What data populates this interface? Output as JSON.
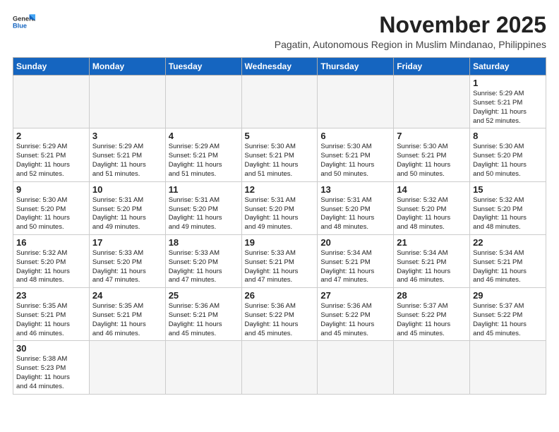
{
  "header": {
    "logo_general": "General",
    "logo_blue": "Blue",
    "month_year": "November 2025",
    "subtitle": "Pagatin, Autonomous Region in Muslim Mindanao, Philippines"
  },
  "weekdays": [
    "Sunday",
    "Monday",
    "Tuesday",
    "Wednesday",
    "Thursday",
    "Friday",
    "Saturday"
  ],
  "weeks": [
    [
      {
        "day": "",
        "info": ""
      },
      {
        "day": "",
        "info": ""
      },
      {
        "day": "",
        "info": ""
      },
      {
        "day": "",
        "info": ""
      },
      {
        "day": "",
        "info": ""
      },
      {
        "day": "",
        "info": ""
      },
      {
        "day": "1",
        "info": "Sunrise: 5:29 AM\nSunset: 5:21 PM\nDaylight: 11 hours\nand 52 minutes."
      }
    ],
    [
      {
        "day": "2",
        "info": "Sunrise: 5:29 AM\nSunset: 5:21 PM\nDaylight: 11 hours\nand 52 minutes."
      },
      {
        "day": "3",
        "info": "Sunrise: 5:29 AM\nSunset: 5:21 PM\nDaylight: 11 hours\nand 51 minutes."
      },
      {
        "day": "4",
        "info": "Sunrise: 5:29 AM\nSunset: 5:21 PM\nDaylight: 11 hours\nand 51 minutes."
      },
      {
        "day": "5",
        "info": "Sunrise: 5:30 AM\nSunset: 5:21 PM\nDaylight: 11 hours\nand 51 minutes."
      },
      {
        "day": "6",
        "info": "Sunrise: 5:30 AM\nSunset: 5:21 PM\nDaylight: 11 hours\nand 50 minutes."
      },
      {
        "day": "7",
        "info": "Sunrise: 5:30 AM\nSunset: 5:21 PM\nDaylight: 11 hours\nand 50 minutes."
      },
      {
        "day": "8",
        "info": "Sunrise: 5:30 AM\nSunset: 5:20 PM\nDaylight: 11 hours\nand 50 minutes."
      }
    ],
    [
      {
        "day": "9",
        "info": "Sunrise: 5:30 AM\nSunset: 5:20 PM\nDaylight: 11 hours\nand 50 minutes."
      },
      {
        "day": "10",
        "info": "Sunrise: 5:31 AM\nSunset: 5:20 PM\nDaylight: 11 hours\nand 49 minutes."
      },
      {
        "day": "11",
        "info": "Sunrise: 5:31 AM\nSunset: 5:20 PM\nDaylight: 11 hours\nand 49 minutes."
      },
      {
        "day": "12",
        "info": "Sunrise: 5:31 AM\nSunset: 5:20 PM\nDaylight: 11 hours\nand 49 minutes."
      },
      {
        "day": "13",
        "info": "Sunrise: 5:31 AM\nSunset: 5:20 PM\nDaylight: 11 hours\nand 48 minutes."
      },
      {
        "day": "14",
        "info": "Sunrise: 5:32 AM\nSunset: 5:20 PM\nDaylight: 11 hours\nand 48 minutes."
      },
      {
        "day": "15",
        "info": "Sunrise: 5:32 AM\nSunset: 5:20 PM\nDaylight: 11 hours\nand 48 minutes."
      }
    ],
    [
      {
        "day": "16",
        "info": "Sunrise: 5:32 AM\nSunset: 5:20 PM\nDaylight: 11 hours\nand 48 minutes."
      },
      {
        "day": "17",
        "info": "Sunrise: 5:33 AM\nSunset: 5:20 PM\nDaylight: 11 hours\nand 47 minutes."
      },
      {
        "day": "18",
        "info": "Sunrise: 5:33 AM\nSunset: 5:20 PM\nDaylight: 11 hours\nand 47 minutes."
      },
      {
        "day": "19",
        "info": "Sunrise: 5:33 AM\nSunset: 5:21 PM\nDaylight: 11 hours\nand 47 minutes."
      },
      {
        "day": "20",
        "info": "Sunrise: 5:34 AM\nSunset: 5:21 PM\nDaylight: 11 hours\nand 47 minutes."
      },
      {
        "day": "21",
        "info": "Sunrise: 5:34 AM\nSunset: 5:21 PM\nDaylight: 11 hours\nand 46 minutes."
      },
      {
        "day": "22",
        "info": "Sunrise: 5:34 AM\nSunset: 5:21 PM\nDaylight: 11 hours\nand 46 minutes."
      }
    ],
    [
      {
        "day": "23",
        "info": "Sunrise: 5:35 AM\nSunset: 5:21 PM\nDaylight: 11 hours\nand 46 minutes."
      },
      {
        "day": "24",
        "info": "Sunrise: 5:35 AM\nSunset: 5:21 PM\nDaylight: 11 hours\nand 46 minutes."
      },
      {
        "day": "25",
        "info": "Sunrise: 5:36 AM\nSunset: 5:21 PM\nDaylight: 11 hours\nand 45 minutes."
      },
      {
        "day": "26",
        "info": "Sunrise: 5:36 AM\nSunset: 5:22 PM\nDaylight: 11 hours\nand 45 minutes."
      },
      {
        "day": "27",
        "info": "Sunrise: 5:36 AM\nSunset: 5:22 PM\nDaylight: 11 hours\nand 45 minutes."
      },
      {
        "day": "28",
        "info": "Sunrise: 5:37 AM\nSunset: 5:22 PM\nDaylight: 11 hours\nand 45 minutes."
      },
      {
        "day": "29",
        "info": "Sunrise: 5:37 AM\nSunset: 5:22 PM\nDaylight: 11 hours\nand 45 minutes."
      }
    ],
    [
      {
        "day": "30",
        "info": "Sunrise: 5:38 AM\nSunset: 5:23 PM\nDaylight: 11 hours\nand 44 minutes."
      },
      {
        "day": "",
        "info": ""
      },
      {
        "day": "",
        "info": ""
      },
      {
        "day": "",
        "info": ""
      },
      {
        "day": "",
        "info": ""
      },
      {
        "day": "",
        "info": ""
      },
      {
        "day": "",
        "info": ""
      }
    ]
  ]
}
